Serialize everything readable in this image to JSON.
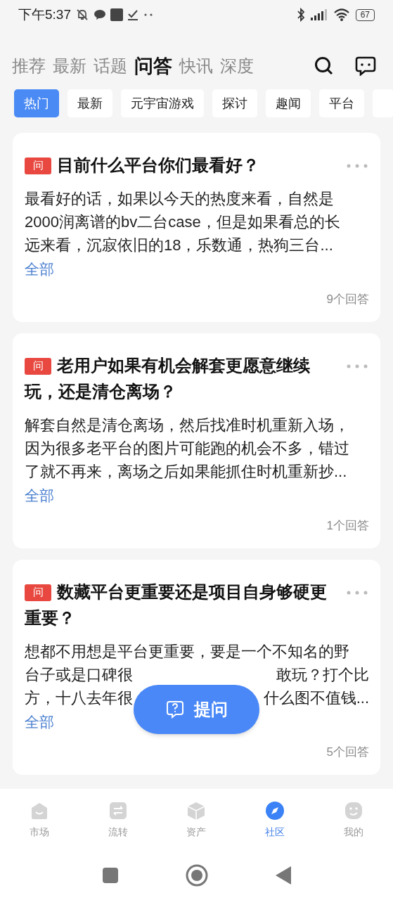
{
  "status_bar": {
    "time": "下午5:37",
    "battery": "67"
  },
  "top_tabs": [
    {
      "label": "推荐",
      "selected": false
    },
    {
      "label": "最新",
      "selected": false
    },
    {
      "label": "话题",
      "selected": false
    },
    {
      "label": "问答",
      "selected": true
    },
    {
      "label": "快讯",
      "selected": false
    },
    {
      "label": "深度",
      "selected": false
    }
  ],
  "chips": [
    {
      "label": "热门",
      "selected": true
    },
    {
      "label": "最新",
      "selected": false
    },
    {
      "label": "元宇宙游戏",
      "selected": false
    },
    {
      "label": "探讨",
      "selected": false
    },
    {
      "label": "趣闻",
      "selected": false
    },
    {
      "label": "平台",
      "selected": false
    }
  ],
  "questions": [
    {
      "badge": "问",
      "title_lines": [
        "目前什么平台你们最看好？"
      ],
      "body_lines": [
        [
          "最看好的话，如果以今天的热度来看，自然是"
        ],
        [
          "2000润离谱的bv二台case，但是如果看总的长"
        ],
        [
          "远来看，沉寂依旧的18，乐数通，热狗三台..."
        ]
      ],
      "more": "全部",
      "answers": "9个回答"
    },
    {
      "badge": "问",
      "title_lines": [
        "老用户如果有机会解套更愿意继续",
        "玩，还是清仓离场？"
      ],
      "body_lines": [
        [
          "解套自然是清仓离场，然后找准时机重新入场，"
        ],
        [
          "因为很多老平台的图片可能跑的机会不多，错过"
        ],
        [
          "了就不再来，离场之后如果能抓住时机重新抄..."
        ]
      ],
      "more": "全部",
      "answers": "1个回答"
    },
    {
      "badge": "问",
      "title_lines": [
        "数藏平台更重要还是项目自身够硬更",
        "重要？"
      ],
      "body_lines": [
        [
          "想都不用想是平台更重要，要是一个不知名的野"
        ],
        [
          "台子或是口碑很",
          "敢玩？打个比"
        ],
        [
          "方，十八去年很",
          "什么图不值钱..."
        ]
      ],
      "more": "全部",
      "answers": "5个回答"
    }
  ],
  "ask_button": "提问",
  "bottom_nav": [
    {
      "label": "市场",
      "selected": false
    },
    {
      "label": "流转",
      "selected": false
    },
    {
      "label": "资产",
      "selected": false
    },
    {
      "label": "社区",
      "selected": true
    },
    {
      "label": "我的",
      "selected": false
    }
  ]
}
